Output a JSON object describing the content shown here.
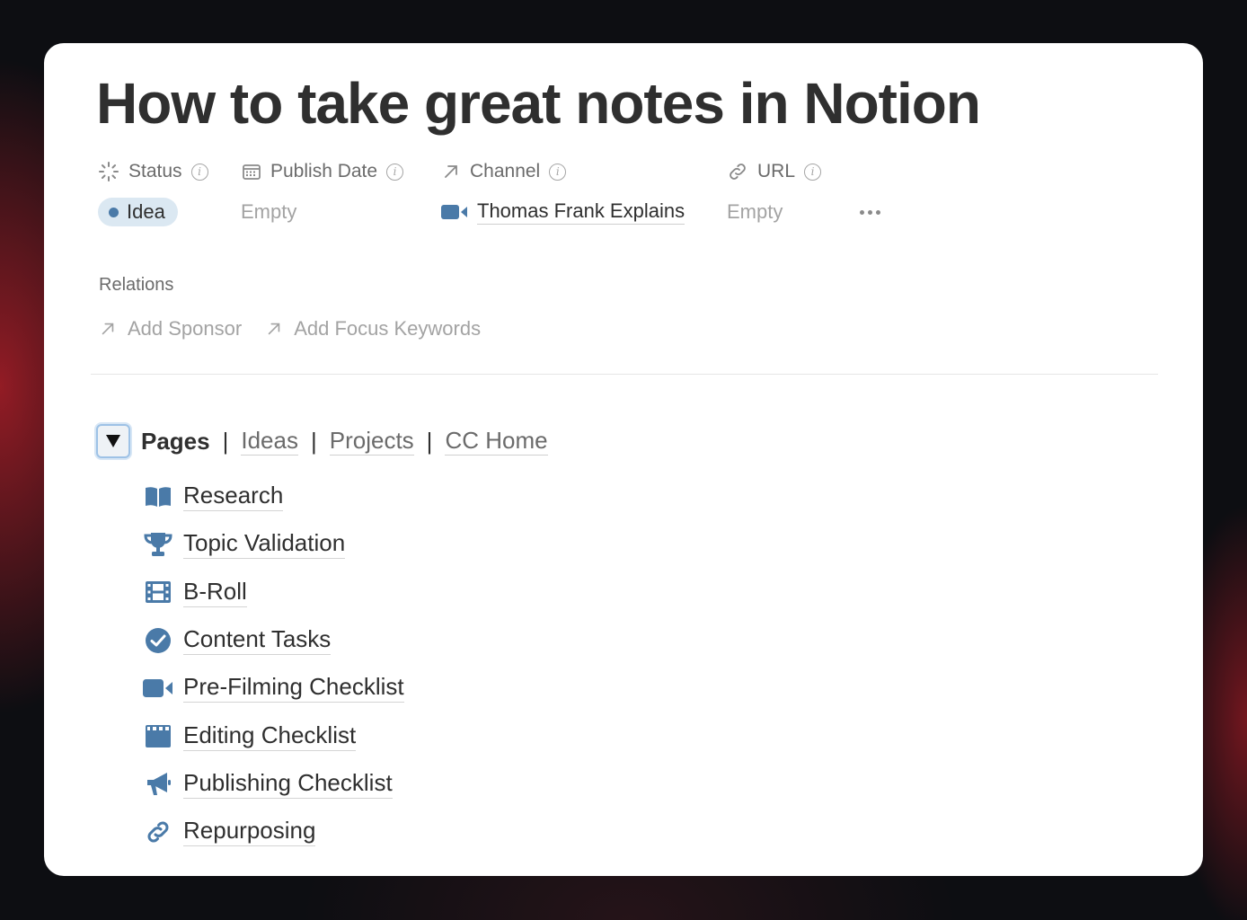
{
  "page": {
    "title": "How to take great notes in Notion"
  },
  "properties": {
    "status": {
      "label": "Status",
      "value": "Idea"
    },
    "publish_date": {
      "label": "Publish Date",
      "value": "Empty"
    },
    "channel": {
      "label": "Channel",
      "value": "Thomas Frank Explains"
    },
    "url": {
      "label": "URL",
      "value": "Empty"
    }
  },
  "relations": {
    "label": "Relations",
    "items": [
      {
        "label": "Add Sponsor"
      },
      {
        "label": "Add Focus Keywords"
      }
    ]
  },
  "toggle": {
    "title": "Pages",
    "separator": "|",
    "links": [
      {
        "label": "Ideas"
      },
      {
        "label": "Projects"
      },
      {
        "label": "CC Home"
      }
    ]
  },
  "pages": [
    {
      "label": "Research",
      "icon": "book-icon"
    },
    {
      "label": "Topic Validation",
      "icon": "trophy-icon"
    },
    {
      "label": "B-Roll",
      "icon": "film-icon"
    },
    {
      "label": "Content Tasks",
      "icon": "check-circle-icon"
    },
    {
      "label": "Pre-Filming Checklist",
      "icon": "video-camera-icon"
    },
    {
      "label": "Editing Checklist",
      "icon": "clapperboard-icon"
    },
    {
      "label": "Publishing Checklist",
      "icon": "megaphone-icon"
    },
    {
      "label": "Repurposing",
      "icon": "link-icon"
    }
  ],
  "colors": {
    "accent_icon": "#4a7aa8",
    "status_pill_bg": "#dbe8f2",
    "title_text": "#2f2f2f",
    "muted_text": "#a3a3a3"
  }
}
